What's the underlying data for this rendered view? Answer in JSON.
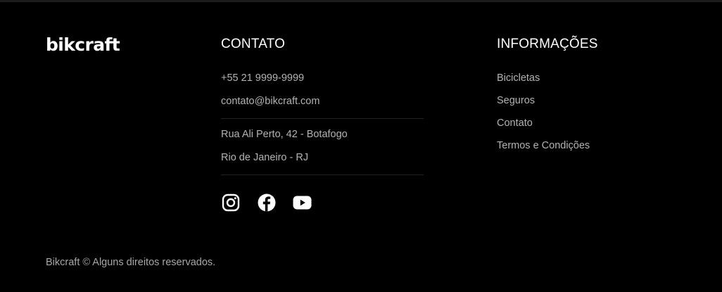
{
  "brand": {
    "logo": "bikcraft"
  },
  "contato": {
    "title": "CONTATO",
    "phone": "+55 21 9999-9999",
    "email": "contato@bikcraft.com",
    "address_line1": "Rua Ali Perto, 42 - Botafogo",
    "address_line2": "Rio de Janeiro - RJ",
    "socials": [
      {
        "name": "instagram-icon"
      },
      {
        "name": "facebook-icon"
      },
      {
        "name": "youtube-icon"
      }
    ]
  },
  "informacoes": {
    "title": "INFORMAÇÕES",
    "links": [
      "Bicicletas",
      "Seguros",
      "Contato",
      "Termos e Condições"
    ]
  },
  "footer": {
    "copyright": "Bikcraft © Alguns direitos reservados."
  },
  "colors": {
    "background": "#000000",
    "text": "#ffffff",
    "muted": "#b3b3b3"
  }
}
